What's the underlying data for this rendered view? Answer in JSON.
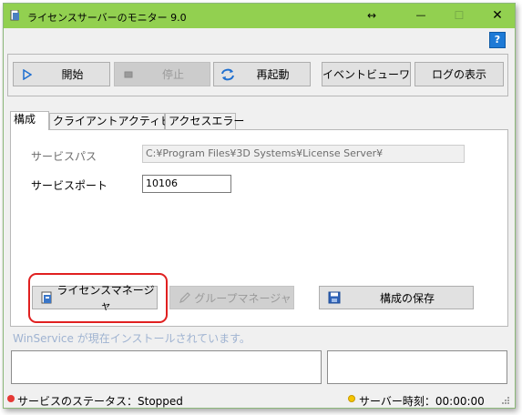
{
  "window": {
    "title": "ライセンスサーバーのモニター 9.0",
    "titlebar_color": "#92d050",
    "controls": {
      "resize": "↔",
      "minimize": "—",
      "maximize": "☐",
      "close": "✕"
    },
    "help_label": "?"
  },
  "toolbar": {
    "start": "開始",
    "stop": "停止",
    "restart": "再起動",
    "event_viewer": "イベントビューワ",
    "show_log": "ログの表示"
  },
  "tabs": [
    "構成",
    "クライアントアクティビティ",
    "アクセスエラー"
  ],
  "config": {
    "service_path_label": "サービスパス",
    "service_path_value": "C:¥Program Files¥3D Systems¥License Server¥",
    "service_port_label": "サービスポート",
    "service_port_value": "10106",
    "license_manager_button": "ライセンスマネージャ",
    "group_manager_button": "グループマネージャ",
    "save_config_button": "構成の保存"
  },
  "info_text": "WinService が現在インストールされています。",
  "status": {
    "service_status": "サービスのステータス：Stopped",
    "server_time": "サーバー時刻：00:00:00",
    "stopped_color": "#e53935",
    "clock_color": "#e0b000"
  }
}
